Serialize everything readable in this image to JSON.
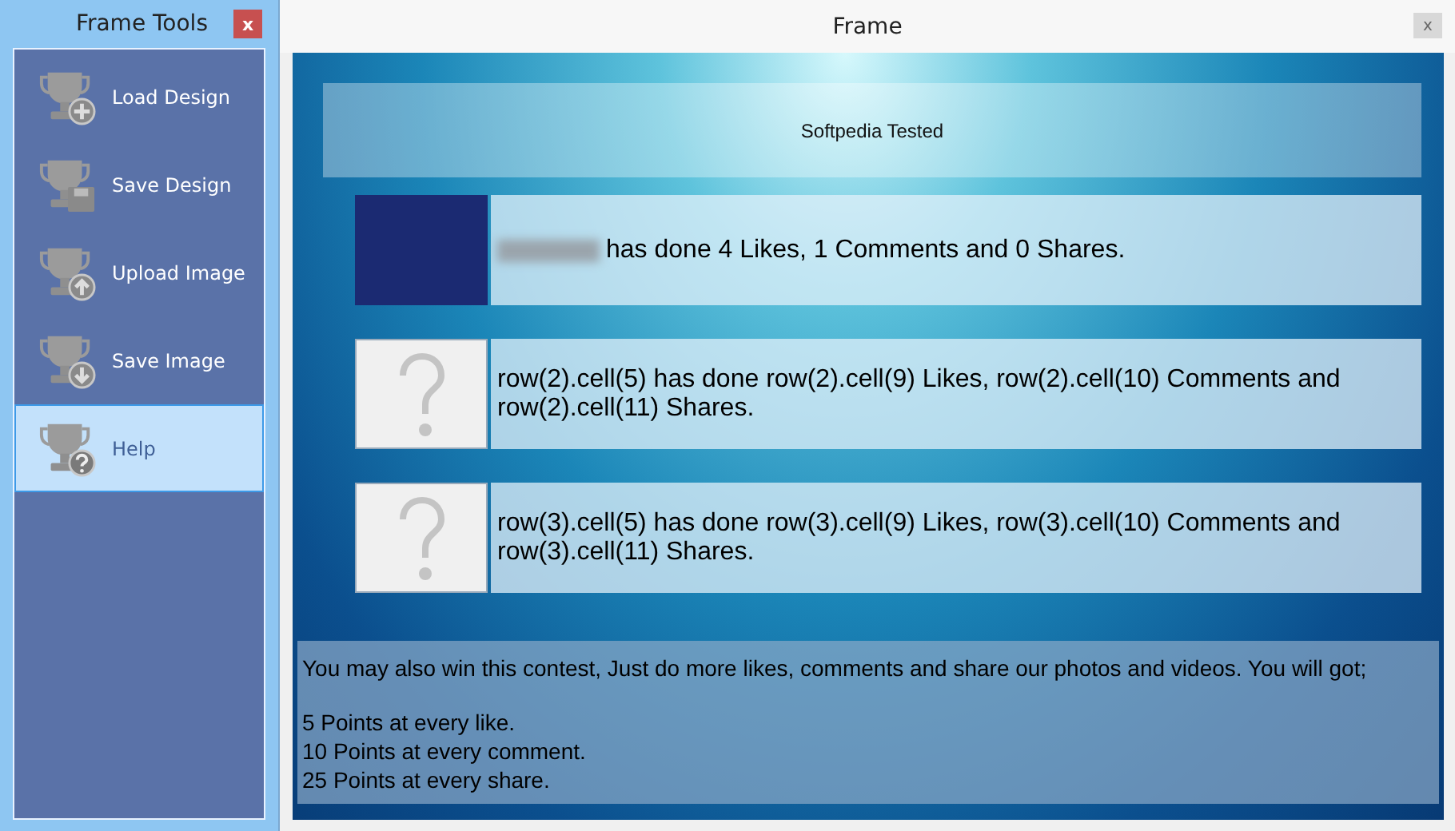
{
  "tools_panel": {
    "title": "Frame Tools",
    "close": "x",
    "items": [
      {
        "label": "Load Design",
        "kind": "add",
        "selected": false
      },
      {
        "label": "Save Design",
        "kind": "disk",
        "selected": false
      },
      {
        "label": "Upload Image",
        "kind": "up",
        "selected": false
      },
      {
        "label": "Save Image",
        "kind": "down",
        "selected": false
      },
      {
        "label": "Help",
        "kind": "help",
        "selected": true
      }
    ]
  },
  "frame": {
    "title": "Frame",
    "close": "x",
    "header": "Softpedia Tested",
    "rows": [
      {
        "kind": "image",
        "name_blurred": true,
        "text": "has done 4 Likes, 1 Comments and 0 Shares."
      },
      {
        "kind": "unknown",
        "name_blurred": false,
        "text": "row(2).cell(5) has done row(2).cell(9) Likes, row(2).cell(10) Comments and row(2).cell(11) Shares."
      },
      {
        "kind": "unknown",
        "name_blurred": false,
        "text": "row(3).cell(5) has done row(3).cell(9) Likes, row(3).cell(10) Comments and row(3).cell(11) Shares."
      }
    ],
    "info": {
      "intro": "You may also win this contest, Just do more likes, comments and share our photos and videos. You will got;",
      "points": [
        "5 Points at every like.",
        "10 Points at every comment.",
        "25 Points at every share."
      ]
    }
  }
}
